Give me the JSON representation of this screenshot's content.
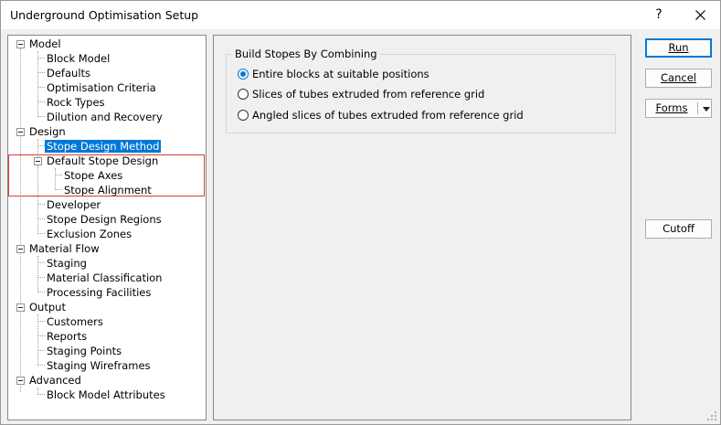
{
  "window": {
    "title": "Underground Optimisation Setup",
    "help_label": "?"
  },
  "tree": {
    "groups": [
      {
        "label": "Model",
        "children": [
          "Block Model",
          "Defaults",
          "Optimisation Criteria",
          "Rock Types",
          "Dilution and Recovery"
        ]
      },
      {
        "label": "Design",
        "children": [
          "Stope Design Method",
          "Default Stope Design",
          "Developer",
          "Stope Design Regions",
          "Exclusion Zones"
        ],
        "sub": {
          "parent": "Default Stope Design",
          "children": [
            "Stope Axes",
            "Stope Alignment"
          ]
        }
      },
      {
        "label": "Material Flow",
        "children": [
          "Staging",
          "Material Classification",
          "Processing Facilities"
        ]
      },
      {
        "label": "Output",
        "children": [
          "Customers",
          "Reports",
          "Staging Points",
          "Staging Wireframes"
        ]
      },
      {
        "label": "Advanced",
        "children": [
          "Block Model Attributes"
        ]
      }
    ],
    "selected": "Stope Design Method"
  },
  "panel": {
    "group_title": "Build Stopes By Combining",
    "options": [
      {
        "label": "Entire blocks at suitable positions",
        "checked": true
      },
      {
        "label": "Slices of tubes extruded from reference grid",
        "checked": false
      },
      {
        "label": "Angled slices of tubes extruded from reference grid",
        "checked": false
      }
    ]
  },
  "buttons": {
    "run": "Run",
    "cancel": "Cancel",
    "forms": "Forms",
    "cutoff": "Cutoff"
  },
  "colors": {
    "accent": "#0078d7",
    "highlight_box": "#d63b3b"
  }
}
